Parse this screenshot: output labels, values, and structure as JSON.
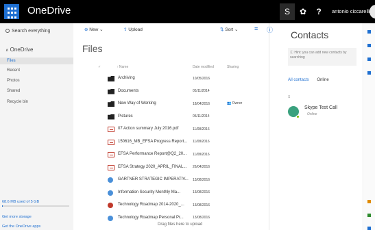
{
  "topbar": {
    "app_name": "OneDrive",
    "user_name": "antonio ciccarelli",
    "help_glyph": "?",
    "skype_glyph": "S",
    "gear_glyph": "✿",
    "icons": [
      "waffle-icon",
      "skype-icon",
      "gear-icon",
      "help-icon",
      "user-avatar"
    ]
  },
  "leftnav": {
    "search_placeholder": "Search everything",
    "root_label": "OneDrive",
    "items": [
      {
        "label": "Files",
        "selected": true
      },
      {
        "label": "Recent"
      },
      {
        "label": "Photos"
      },
      {
        "label": "Shared"
      },
      {
        "label": "Recycle bin"
      }
    ],
    "storage_text": "68.6 MB used of 5 GB",
    "storage_fraction": 0.0134,
    "more_storage": "Get more storage",
    "get_apps": "Get the OneDrive apps"
  },
  "commands": {
    "new_label": "New",
    "upload_label": "Upload",
    "sort_label": "Sort"
  },
  "main": {
    "title": "Files",
    "columns": {
      "name": "Name",
      "date": "Date modified",
      "sharing": "Sharing"
    },
    "rows": [
      {
        "name": "Archiving",
        "date": "10/05/2016",
        "sharing": "",
        "icon": "folder"
      },
      {
        "name": "Documents",
        "date": "05/11/2014",
        "sharing": "",
        "icon": "folder"
      },
      {
        "name": "New Way of Working",
        "date": "18/04/2016",
        "sharing": "Owner",
        "icon": "folder"
      },
      {
        "name": "Pictures",
        "date": "05/11/2014",
        "sharing": "",
        "icon": "folder"
      },
      {
        "name": "07 Action summary July 2016.pdf",
        "date": "11/08/2016",
        "sharing": "",
        "icon": "pdf"
      },
      {
        "name": "150616_MB_EFSA Progress Report...",
        "date": "11/08/2016",
        "sharing": "",
        "icon": "pdf"
      },
      {
        "name": "EFSA Performance Report@Q2_20...",
        "date": "11/08/2016",
        "sharing": "",
        "icon": "pdf"
      },
      {
        "name": "EFSA Strategy 2020_APRIL_FINAL...",
        "date": "26/04/2016",
        "sharing": "",
        "icon": "pdf"
      },
      {
        "name": "GARTNER STRATEGIC IMPERATIV...",
        "date": "13/08/2016",
        "sharing": "",
        "icon": "link"
      },
      {
        "name": "Information Security Monthly Ma...",
        "date": "13/08/2016",
        "sharing": "",
        "icon": "link"
      },
      {
        "name": "Technology Roadmap 2014-2020_...",
        "date": "13/08/2016",
        "sharing": "",
        "icon": "link-red"
      },
      {
        "name": "Technology Roadmap Personal Pr...",
        "date": "13/08/2016",
        "sharing": "",
        "icon": "link"
      }
    ],
    "drag_hint": "Drag files here to upload"
  },
  "contacts": {
    "title": "Contacts",
    "hint": "Hint: you can add new contacts by searching",
    "tab_all": "All contacts",
    "tab_online": "Online",
    "group_letter": "S",
    "contact_name": "Skype Test Call",
    "contact_status": "Online"
  },
  "colors": {
    "accent": "#1e6fd1",
    "topbar": "#000000",
    "online": "#7fba00"
  }
}
